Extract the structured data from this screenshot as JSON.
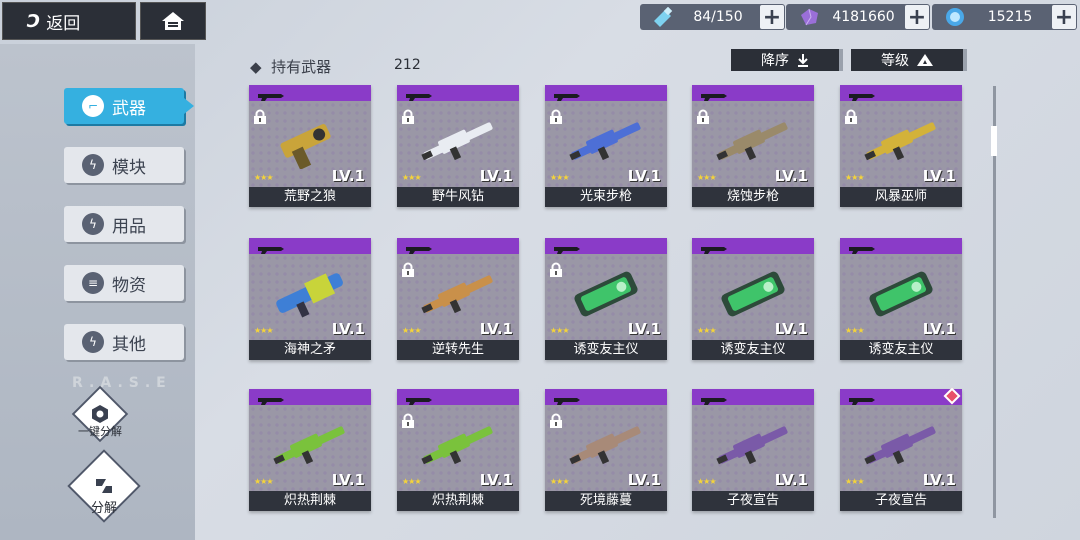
{
  "header": {
    "back_label": "返回",
    "back_logo": "Ɔ",
    "resources": [
      {
        "icon": "stamina-bottle-icon",
        "value": "84/150"
      },
      {
        "icon": "purple-crystal-icon",
        "value": "4181660"
      },
      {
        "icon": "blue-orb-icon",
        "value": "15215"
      }
    ],
    "plus": "+"
  },
  "sidebar": {
    "items": [
      {
        "label": "武器",
        "active": true,
        "icon": "gun-icon"
      },
      {
        "label": "模块",
        "active": false,
        "icon": "bolt-icon"
      },
      {
        "label": "用品",
        "active": false,
        "icon": "bolt-icon"
      },
      {
        "label": "物资",
        "active": false,
        "icon": "box-icon"
      },
      {
        "label": "其他",
        "active": false,
        "icon": "bolt-icon"
      }
    ],
    "watermark": "R.A.S.E",
    "quick_dismantle_label": "一键分解",
    "dismantle_label": "分解"
  },
  "inventory": {
    "title": "持有武器",
    "count": "212",
    "sort_order_label": "降序",
    "sort_level_label": "等级"
  },
  "accent_color": "#35b0e0",
  "rarity_color": "#8a3bc8",
  "weapons": [
    {
      "name": "荒野之狼",
      "level": "LV.1",
      "stars": "★★★",
      "locked": true,
      "type": "pistol",
      "gun_color": "#c9a43a"
    },
    {
      "name": "野牛风钻",
      "level": "LV.1",
      "stars": "★★★",
      "locked": true,
      "type": "shotgun",
      "gun_color": "#e9ecf2"
    },
    {
      "name": "光束步枪",
      "level": "LV.1",
      "stars": "★★★",
      "locked": true,
      "type": "rifle",
      "gun_color": "#4d6fd6"
    },
    {
      "name": "烧蚀步枪",
      "level": "LV.1",
      "stars": "★★★",
      "locked": true,
      "type": "rifle",
      "gun_color": "#9a8a6a"
    },
    {
      "name": "风暴巫师",
      "level": "LV.1",
      "stars": "★★★",
      "locked": true,
      "type": "smg",
      "gun_color": "#d3b23a"
    },
    {
      "name": "海神之矛",
      "level": "LV.1",
      "stars": "★★★",
      "locked": false,
      "type": "launcher",
      "gun_color": "#3e7fd6"
    },
    {
      "name": "逆转先生",
      "level": "LV.1",
      "stars": "★★★",
      "locked": true,
      "type": "shotgun",
      "gun_color": "#c9904a"
    },
    {
      "name": "诱变友主仪",
      "level": "LV.1",
      "stars": "★★★",
      "locked": true,
      "type": "device",
      "gun_color": "#3fc46a"
    },
    {
      "name": "诱变友主仪",
      "level": "LV.1",
      "stars": "★★★",
      "locked": false,
      "type": "device",
      "gun_color": "#3fc46a"
    },
    {
      "name": "诱变友主仪",
      "level": "LV.1",
      "stars": "★★★",
      "locked": false,
      "type": "device",
      "gun_color": "#3fc46a"
    },
    {
      "name": "炽热荆棘",
      "level": "LV.1",
      "stars": "★★★",
      "locked": false,
      "type": "sniper",
      "gun_color": "#7ac23c"
    },
    {
      "name": "炽热荆棘",
      "level": "LV.1",
      "stars": "★★★",
      "locked": true,
      "type": "sniper",
      "gun_color": "#7ac23c"
    },
    {
      "name": "死境藤蔓",
      "level": "LV.1",
      "stars": "★★★",
      "locked": true,
      "type": "sniper",
      "gun_color": "#a88a78"
    },
    {
      "name": "子夜宣告",
      "level": "LV.1",
      "stars": "★★★",
      "locked": false,
      "type": "sniper",
      "gun_color": "#7a5aa8"
    },
    {
      "name": "子夜宣告",
      "level": "LV.1",
      "stars": "★★★",
      "locked": false,
      "type": "sniper",
      "gun_color": "#7a5aa8",
      "new": true
    }
  ]
}
